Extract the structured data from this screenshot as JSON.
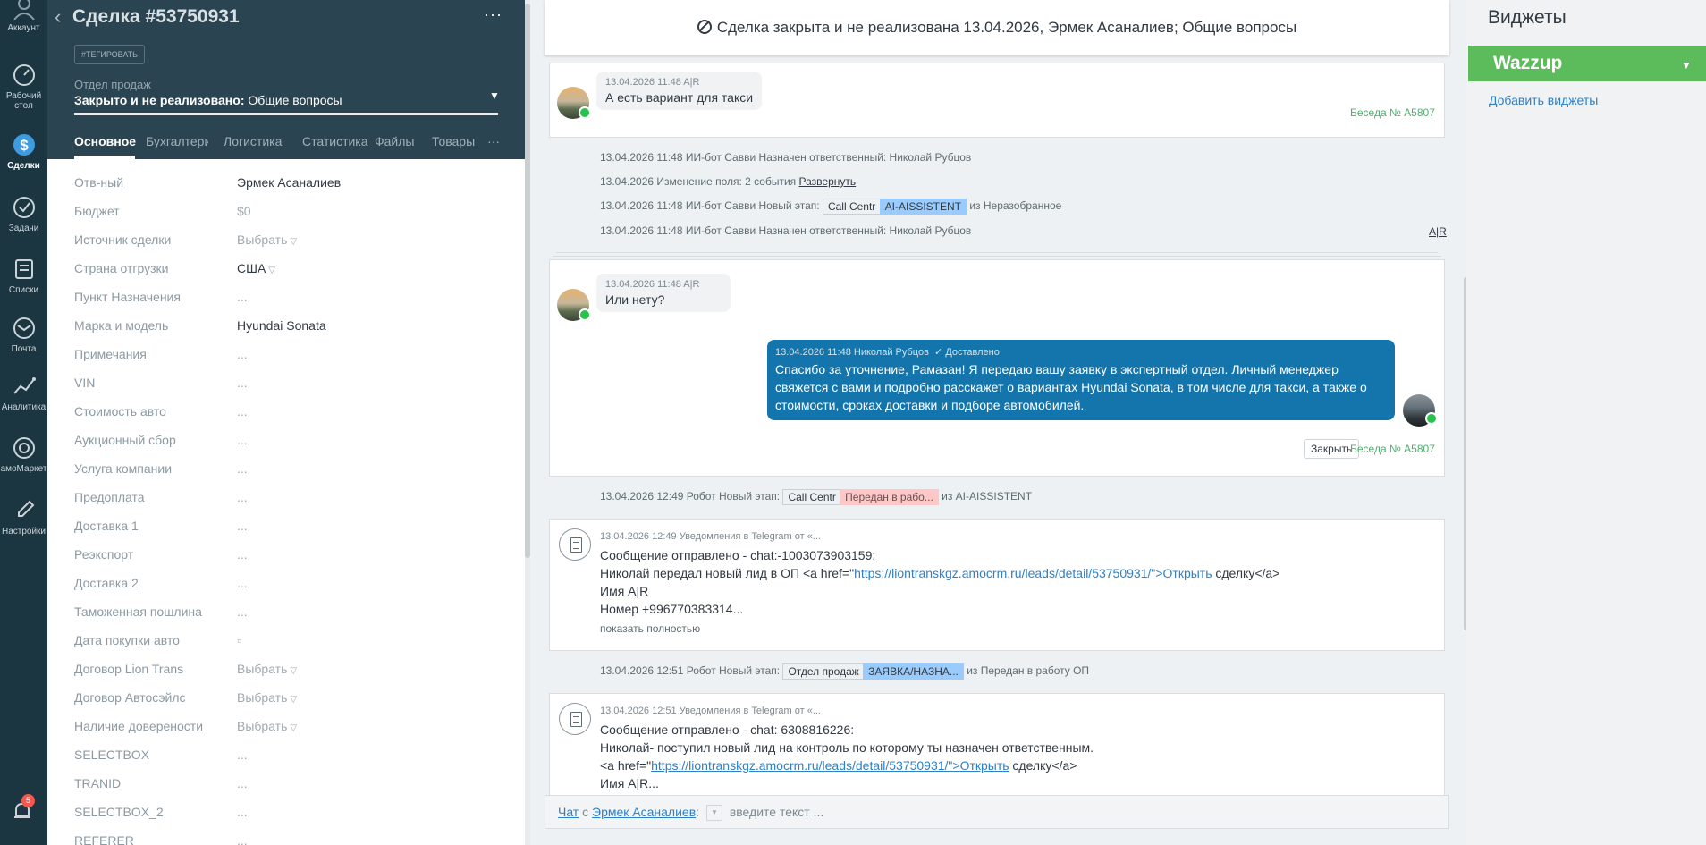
{
  "nav": {
    "items": [
      {
        "label": "Аккаунт",
        "icon": "account-icon"
      },
      {
        "label": "Рабочий стол",
        "icon": "dashboard-icon"
      },
      {
        "label": "Сделки",
        "icon": "deals-icon"
      },
      {
        "label": "Задачи",
        "icon": "tasks-icon"
      },
      {
        "label": "Списки",
        "icon": "lists-icon"
      },
      {
        "label": "Почта",
        "icon": "mail-icon"
      },
      {
        "label": "Аналитика",
        "icon": "analytics-icon"
      },
      {
        "label": "амоМаркет",
        "icon": "market-icon"
      },
      {
        "label": "Настройки",
        "icon": "settings-icon"
      }
    ],
    "notifications_count": "5"
  },
  "lead": {
    "title": "Сделка #53750931",
    "more_label": "···",
    "tag_button": "#ТЕГИРОВАТЬ",
    "pipeline": "Отдел продаж",
    "status_prefix": "Закрыто и не реализовано:",
    "status_value": "Общие вопросы",
    "tabs": [
      "Основное",
      "Бухгалтерия",
      "Логистика",
      "Статистика",
      "Файлы",
      "Товары",
      "···"
    ],
    "fields": [
      {
        "label": "Отв-ный",
        "value": "Эрмек Асаналиев"
      },
      {
        "label": "Бюджет",
        "value": "$0"
      },
      {
        "label": "Источник сделки",
        "value": "Выбрать"
      },
      {
        "label": "Страна отгрузки",
        "value": "США"
      },
      {
        "label": "Пункт Назначения",
        "value": "..."
      },
      {
        "label": "Марка и модель",
        "value": "Hyundai Sonata"
      },
      {
        "label": "Примечания",
        "value": "..."
      },
      {
        "label": "VIN",
        "value": "..."
      },
      {
        "label": "Стоимость авто",
        "value": "..."
      },
      {
        "label": "Аукционный сбор",
        "value": "..."
      },
      {
        "label": "Услуга компании",
        "value": "..."
      },
      {
        "label": "Предоплата",
        "value": "..."
      },
      {
        "label": "Доставка 1",
        "value": "..."
      },
      {
        "label": "Реэкспорт",
        "value": "..."
      },
      {
        "label": "Доставка 2",
        "value": "..."
      },
      {
        "label": "Таможенная пошлина",
        "value": "..."
      },
      {
        "label": "Дата покупки авто",
        "value": "▫"
      },
      {
        "label": "Договор Lion Trans",
        "value": "Выбрать"
      },
      {
        "label": "Договор Автосэйлс",
        "value": "Выбрать"
      },
      {
        "label": "Наличие доверености",
        "value": "Выбрать"
      },
      {
        "label": "SELECTBOX",
        "value": "..."
      },
      {
        "label": "TRANID",
        "value": "..."
      },
      {
        "label": "SELECTBOX_2",
        "value": "..."
      },
      {
        "label": "REFERER",
        "value": "..."
      }
    ]
  },
  "feed": {
    "closed_banner": "Сделка закрыта и не реализована 13.04.2026, Эрмек Асаналиев; Общие вопросы",
    "msg1": {
      "meta": "13.04.2026 11:48 A|R",
      "text": "А есть вариант для такси",
      "conv": "Беседа № A5807"
    },
    "events1": [
      {
        "text": "13.04.2026 11:48 ИИ-бот Савви Назначен ответственный: Николай Рубцов"
      },
      {
        "text": "13.04.2026 Изменение поля: 2 события",
        "link": "Развернуть"
      },
      {
        "text": "13.04.2026 11:48 ИИ-бот Савви Новый этап:",
        "pill1": "Call Centr",
        "pill2": "AI-AISSISTENT",
        "tail": "из Неразобранное"
      },
      {
        "text": "13.04.2026 11:48 ИИ-бот Савви Назначен ответственный: Николай Рубцов"
      }
    ],
    "ar_link": "A|R",
    "msg2": {
      "meta": "13.04.2026 11:48 A|R",
      "text": "Или нету?"
    },
    "msg3": {
      "meta": "13.04.2026 11:48 Николай Рубцов",
      "delivered": "✓ Доставлено",
      "lines": [
        "Спасибо за уточнение, Рамазан! Я передаю вашу заявку в экспертный отдел. Личный менеджер",
        "свяжется с вами и подробно расскажет о вариантах Hyundai Sonata, в том числе для такси, а также о",
        "стоимости, сроках доставки и подборе автомобилей."
      ],
      "close_button": "Закрыть",
      "conv": "Беседа № A5807"
    },
    "event2": {
      "text": "13.04.2026 12:49 Робот Новый этап:",
      "pill1": "Call Centr",
      "pill2": "Передан в рабо...",
      "tail": "из AI-AISSISTENT"
    },
    "tg1": {
      "meta": "13.04.2026 12:49 Уведомления в Telegram от «...",
      "line1": "Сообщение отправлено - chat:-1003073903159:",
      "line2_pre": "Николай передал новый лид в ОП <a href=\"",
      "line2_link": "https://liontranskgz.amocrm.ru/leads/detail/53750931/\">Открыть",
      "line2_post": " сделку</a>",
      "line3": "Имя A|R",
      "line4": "Номер +996770383314...",
      "show_full": "показать полностью"
    },
    "event3": {
      "text": "13.04.2026 12:51 Робот Новый этап:",
      "pill1": "Отдел продаж",
      "pill2": "ЗАЯВКА/НАЗНА...",
      "tail": "из Передан в работу ОП"
    },
    "tg2": {
      "meta": "13.04.2026 12:51 Уведомления в Telegram от «...",
      "line1": "Сообщение отправлено - chat: 6308816226:",
      "line2": "Николай- поступил новый лид на контроль по которому ты назначен ответственным.",
      "line3_pre": "<a href=\"",
      "line3_link": "https://liontranskgz.amocrm.ru/leads/detail/53750931/\">Открыть",
      "line3_post": " сделку</a>",
      "line4": "Имя A|R..."
    },
    "chat": {
      "label": "Чат",
      "with": "с",
      "user": "Эрмек Асаналиев",
      "colon": ":",
      "placeholder": "введите текст ..."
    }
  },
  "widgets": {
    "title": "Виджеты",
    "wazzup": "Wazzup",
    "add": "Добавить виджеты"
  },
  "colors": {
    "nav_bg": "#1b3541",
    "lead_head_bg": "#2b4451",
    "outgoing_bubble": "#1375ab",
    "wazzup_green": "#5cbb5b",
    "link_blue": "#2f80c6"
  }
}
